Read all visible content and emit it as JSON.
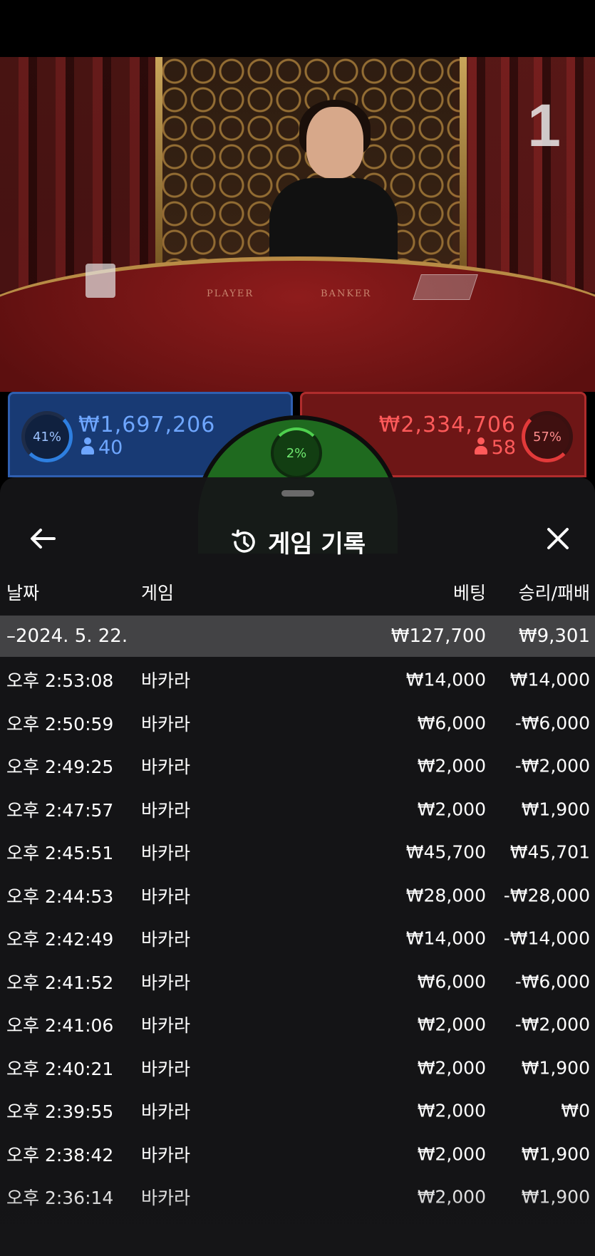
{
  "stream": {
    "round_number": "1",
    "felt_player": "PLAYER",
    "felt_banker": "BANKER"
  },
  "bets": {
    "player": {
      "percent": "41%",
      "amount": "₩1,697,206",
      "count": "40",
      "color": "#2e7fe0"
    },
    "banker": {
      "percent": "57%",
      "amount": "₩2,334,706",
      "count": "58",
      "color": "#e23a3a"
    },
    "tie": {
      "percent": "2%",
      "color": "#4fd04f"
    }
  },
  "history": {
    "title": "게임 기록",
    "icons": {
      "back": "arrow-left-icon",
      "history": "history-clock-icon",
      "close": "close-icon"
    },
    "columns": {
      "date": "날짜",
      "game": "게임",
      "bet": "베팅",
      "result": "승리/패배"
    },
    "date_group": {
      "date": "–2024. 5. 22.",
      "bet": "₩127,700",
      "result": "₩9,301"
    },
    "rows": [
      {
        "time": "오후 2:53:08",
        "game": "바카라",
        "bet": "₩14,000",
        "result": "₩14,000"
      },
      {
        "time": "오후 2:50:59",
        "game": "바카라",
        "bet": "₩6,000",
        "result": "-₩6,000"
      },
      {
        "time": "오후 2:49:25",
        "game": "바카라",
        "bet": "₩2,000",
        "result": "-₩2,000"
      },
      {
        "time": "오후 2:47:57",
        "game": "바카라",
        "bet": "₩2,000",
        "result": "₩1,900"
      },
      {
        "time": "오후 2:45:51",
        "game": "바카라",
        "bet": "₩45,700",
        "result": "₩45,701"
      },
      {
        "time": "오후 2:44:53",
        "game": "바카라",
        "bet": "₩28,000",
        "result": "-₩28,000"
      },
      {
        "time": "오후 2:42:49",
        "game": "바카라",
        "bet": "₩14,000",
        "result": "-₩14,000"
      },
      {
        "time": "오후 2:41:52",
        "game": "바카라",
        "bet": "₩6,000",
        "result": "-₩6,000"
      },
      {
        "time": "오후 2:41:06",
        "game": "바카라",
        "bet": "₩2,000",
        "result": "-₩2,000"
      },
      {
        "time": "오후 2:40:21",
        "game": "바카라",
        "bet": "₩2,000",
        "result": "₩1,900"
      },
      {
        "time": "오후 2:39:55",
        "game": "바카라",
        "bet": "₩2,000",
        "result": "₩0"
      },
      {
        "time": "오후 2:38:42",
        "game": "바카라",
        "bet": "₩2,000",
        "result": "₩1,900"
      },
      {
        "time": "오후 2:36:14",
        "game": "바카라",
        "bet": "₩2,000",
        "result": "₩1,900"
      }
    ]
  }
}
